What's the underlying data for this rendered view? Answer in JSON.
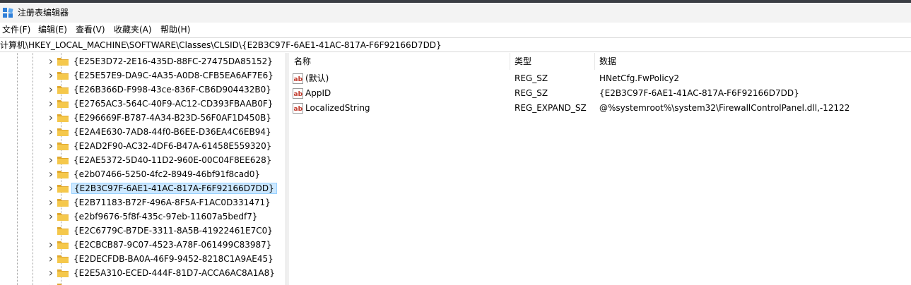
{
  "window": {
    "title": "注册表编辑器"
  },
  "menu": [
    "文件(F)",
    "编辑(E)",
    "查看(V)",
    "收藏夹(A)",
    "帮助(H)"
  ],
  "address": "计算机\\HKEY_LOCAL_MACHINE\\SOFTWARE\\Classes\\CLSID\\{E2B3C97F-6AE1-41AC-817A-F6F92166D7DD}",
  "tree": {
    "items": [
      {
        "label": "{E25E3D72-2E16-435D-88FC-27475DA85152}",
        "expandable": true,
        "selected": false
      },
      {
        "label": "{E25E57E9-DA9C-4A35-A0D8-CFB5EA6AF7E6}",
        "expandable": true,
        "selected": false
      },
      {
        "label": "{E26B366D-F998-43ce-836F-CB6D904432B0}",
        "expandable": true,
        "selected": false
      },
      {
        "label": "{E2765AC3-564C-40F9-AC12-CD393FBAAB0F}",
        "expandable": true,
        "selected": false
      },
      {
        "label": "{E296669F-B787-4A34-B23D-56F0AF1D450B}",
        "expandable": true,
        "selected": false
      },
      {
        "label": "{E2A4E630-7AD8-44f0-B6EE-D36EA4C6EB94}",
        "expandable": true,
        "selected": false
      },
      {
        "label": "{E2AD2F90-AC32-4DF6-B47A-61458E559320}",
        "expandable": true,
        "selected": false
      },
      {
        "label": "{E2AE5372-5D40-11D2-960E-00C04F8EE628}",
        "expandable": true,
        "selected": false
      },
      {
        "label": "{e2b07466-5250-4fc2-8949-46bf91f8cad0}",
        "expandable": true,
        "selected": false
      },
      {
        "label": "{E2B3C97F-6AE1-41AC-817A-F6F92166D7DD}",
        "expandable": true,
        "selected": true
      },
      {
        "label": "{E2B71183-B72F-496A-8F5A-F1AC0D331471}",
        "expandable": true,
        "selected": false
      },
      {
        "label": "{e2bf9676-5f8f-435c-97eb-11607a5bedf7}",
        "expandable": true,
        "selected": false
      },
      {
        "label": "{E2C6779C-B7DE-3311-8A5B-41922461E7C0}",
        "expandable": false,
        "selected": false
      },
      {
        "label": "{E2CBCB87-9C07-4523-A78F-061499C83987}",
        "expandable": true,
        "selected": false
      },
      {
        "label": "{E2DECFDB-BA0A-46F9-9452-8218C1A9AE45}",
        "expandable": true,
        "selected": false
      },
      {
        "label": "{E2E5A310-ECED-444F-81D7-ACCA6AC8A1A8}",
        "expandable": true,
        "selected": false
      },
      {
        "label": "",
        "expandable": true,
        "selected": false
      }
    ]
  },
  "values": {
    "columns": [
      "名称",
      "类型",
      "数据"
    ],
    "rows": [
      {
        "name": "(默认)",
        "type": "REG_SZ",
        "data": "HNetCfg.FwPolicy2",
        "icon": "string-value-icon"
      },
      {
        "name": "AppID",
        "type": "REG_SZ",
        "data": "{E2B3C97F-6AE1-41AC-817A-F6F92166D7DD}",
        "icon": "string-value-icon"
      },
      {
        "name": "LocalizedString",
        "type": "REG_EXPAND_SZ",
        "data": "@%systemroot%\\system32\\FirewallControlPanel.dll,-12122",
        "icon": "string-value-icon"
      }
    ]
  },
  "colors": {
    "selection_bg": "#cce8ff",
    "selection_border": "#99d1ff",
    "folder": "#f5c84c",
    "reg_icon": "#c0392b"
  }
}
